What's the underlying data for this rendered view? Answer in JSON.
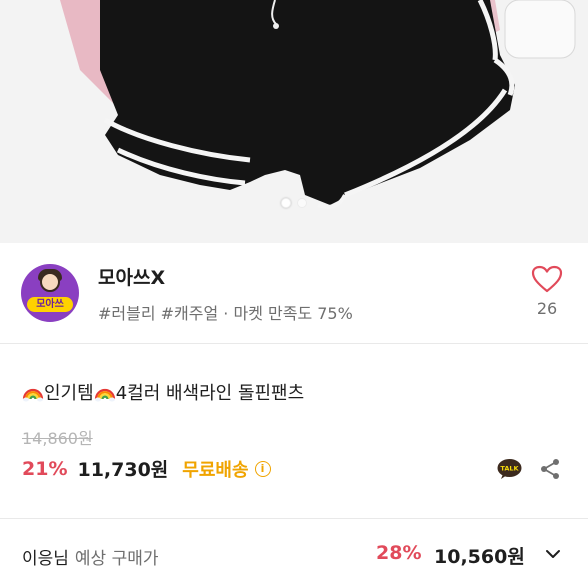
{
  "hero": {
    "image_name": "black-dolphin-shorts-photo",
    "carousel_dots": [
      true,
      false
    ]
  },
  "shop": {
    "avatar_text": "모아쓰",
    "name": "모아쓰X",
    "tags": "#러블리 #캐주얼 · 마켓 만족도 75%",
    "like_count": "26"
  },
  "product": {
    "title": "인기템",
    "title_rest": "4컬러 배색라인 돌핀팬츠",
    "original_price": "14,860원",
    "discount": "21%",
    "price": "11,730원",
    "shipping": "무료배송",
    "info_symbol": "i",
    "talk_label": "TALK"
  },
  "member_price": {
    "user": "이응님",
    "label": "예상 구매가",
    "discount": "28%",
    "price": "10,560원"
  },
  "colors": {
    "discount": "#e14a5a",
    "shipping": "#f0a400",
    "avatar_bg": "#8a3fc1",
    "text_muted": "#6f6f6f"
  }
}
